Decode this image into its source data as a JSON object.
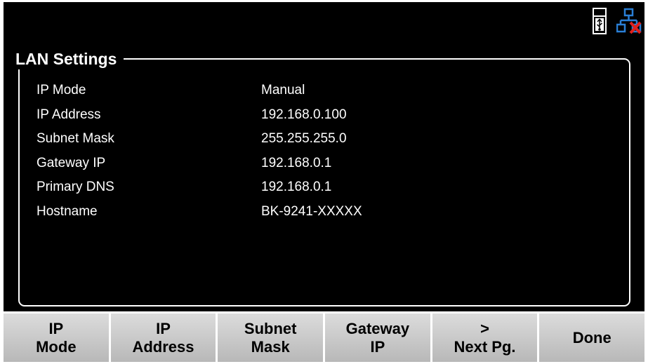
{
  "panel": {
    "title": "LAN Settings"
  },
  "status": {
    "usb_icon": "usb-drive-icon",
    "lan_icon": "network-disconnected-icon",
    "colors": {
      "network": "#2a7fd6",
      "disconnected": "#e0201c"
    }
  },
  "settings": [
    {
      "label": "IP Mode",
      "value": "Manual"
    },
    {
      "label": "IP Address",
      "value": "192.168.0.100"
    },
    {
      "label": "Subnet Mask",
      "value": "255.255.255.0"
    },
    {
      "label": "Gateway IP",
      "value": "192.168.0.1"
    },
    {
      "label": "Primary DNS",
      "value": "192.168.0.1"
    },
    {
      "label": "Hostname",
      "value": "BK-9241-XXXXX"
    }
  ],
  "softkeys": [
    {
      "line1": "IP",
      "line2": "Mode"
    },
    {
      "line1": "IP",
      "line2": "Address"
    },
    {
      "line1": "Subnet",
      "line2": "Mask"
    },
    {
      "line1": "Gateway",
      "line2": "IP"
    },
    {
      "line1": ">",
      "line2": "Next Pg."
    },
    {
      "line1": "Done",
      "line2": ""
    }
  ]
}
